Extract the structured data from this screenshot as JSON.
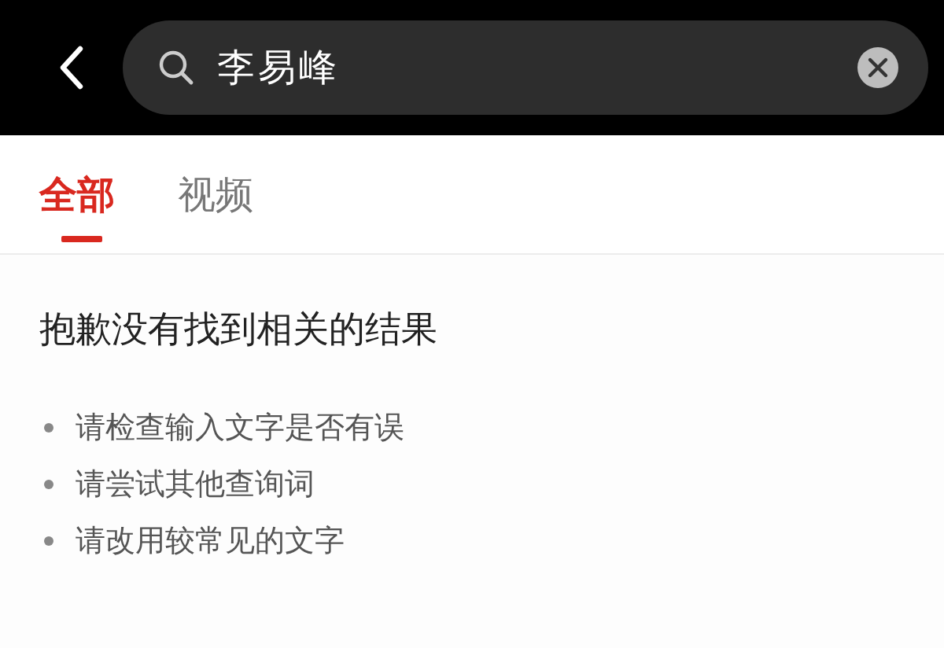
{
  "search_bar": {
    "query": "李易峰"
  },
  "tabs": [
    {
      "label": "全部",
      "selected": true
    },
    {
      "label": "视频",
      "selected": false
    }
  ],
  "empty_state": {
    "title": "抱歉没有找到相关的结果",
    "tips": [
      "请检查输入文字是否有误",
      "请尝试其他查询词",
      "请改用较常见的文字"
    ]
  }
}
